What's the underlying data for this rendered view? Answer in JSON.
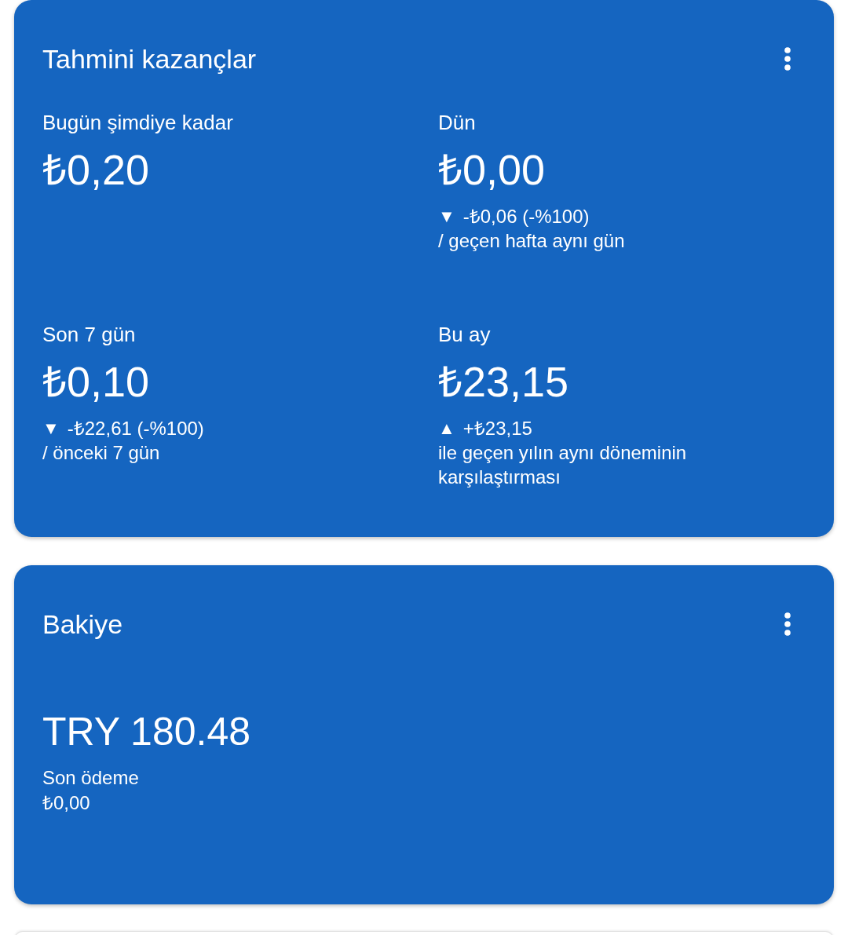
{
  "cards": [
    {
      "kind": "earnings",
      "title": "Tahmini kazançlar",
      "metrics": [
        {
          "label": "Bugün şimdiye kadar",
          "value": "₺0,20"
        },
        {
          "label": "Dün",
          "value": "₺0,00",
          "change": {
            "symbol": "▼",
            "amount": "-₺0,06 (-%100)",
            "comparison": "/ geçen hafta aynı gün"
          }
        },
        {
          "label": "Son 7 gün",
          "value": "₺0,10",
          "change": {
            "symbol": "▼",
            "amount": "-₺22,61 (-%100)",
            "comparison": "/ önceki 7 gün"
          }
        },
        {
          "label": "Bu ay",
          "value": "₺23,15",
          "change": {
            "symbol": "▲",
            "amount": "+₺23,15",
            "comparison": "ile geçen yılın aynı döneminin karşılaştırması"
          }
        }
      ]
    },
    {
      "kind": "balance",
      "title": "Bakiye",
      "amount": "TRY 180.48",
      "last_payment": {
        "label": "Son ödeme",
        "value": "₺0,00"
      }
    }
  ]
}
